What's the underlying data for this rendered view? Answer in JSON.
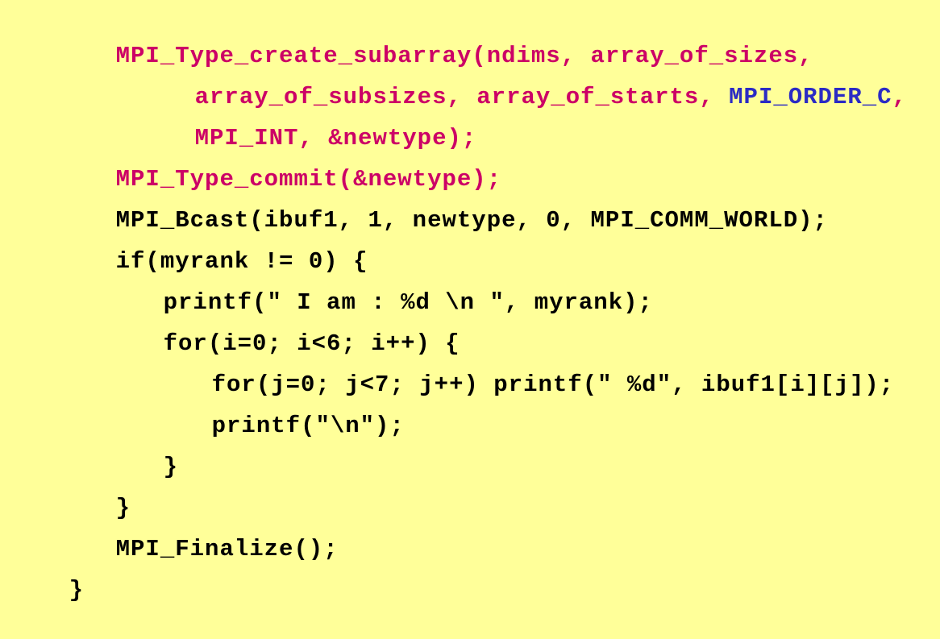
{
  "colors": {
    "background": "#ffff99",
    "mpi_call": "#cc0066",
    "constant": "#2b2bc4",
    "default": "#000000"
  },
  "code": {
    "lines": [
      [
        {
          "text": "MPI_Type_create_subarray(ndims, array_of_sizes,",
          "kind": "mpi_call"
        }
      ],
      [
        {
          "text": "array_of_subsizes, array_of_starts, ",
          "kind": "mpi_call"
        },
        {
          "text": "MPI_ORDER_C",
          "kind": "constant"
        },
        {
          "text": ",",
          "kind": "mpi_call"
        }
      ],
      [
        {
          "text": "MPI_INT, &newtype);",
          "kind": "mpi_call"
        }
      ],
      [
        {
          "text": "MPI_Type_commit(&newtype);",
          "kind": "mpi_call"
        }
      ],
      [
        {
          "text": "MPI_Bcast(ibuf1, 1, newtype, 0, MPI_COMM_WORLD);",
          "kind": "default"
        }
      ],
      [
        {
          "text": "if(myrank != 0) {",
          "kind": "default"
        }
      ],
      [
        {
          "text": "printf(\" I am : %d \\n \", myrank);",
          "kind": "default"
        }
      ],
      [
        {
          "text": "for(i=0; i<6; i++) {",
          "kind": "default"
        }
      ],
      [
        {
          "text": "for(j=0; j<7; j++) printf(\" %d\", ibuf1[i][j]);",
          "kind": "default"
        }
      ],
      [
        {
          "text": "printf(\"\\n\");",
          "kind": "default"
        }
      ],
      [
        {
          "text": "}",
          "kind": "default"
        }
      ],
      [
        {
          "text": "}",
          "kind": "default"
        }
      ],
      [
        {
          "text": "MPI_Finalize();",
          "kind": "default"
        }
      ],
      [
        {
          "text": "}",
          "kind": "default"
        }
      ]
    ]
  }
}
